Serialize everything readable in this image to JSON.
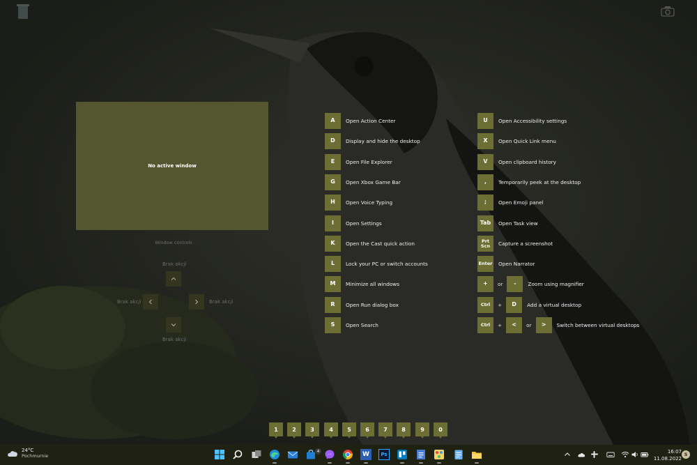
{
  "preview": {
    "message": "No active window",
    "controls_title": "Window controls",
    "direction_labels": {
      "up": "Brak akcji",
      "left": "Brak akcji",
      "right": "Brak akcji",
      "down": "Brak akcji"
    }
  },
  "shortcuts_left": [
    {
      "key": "A",
      "desc": "Open Action Center"
    },
    {
      "key": "D",
      "desc": "Display and hide the desktop"
    },
    {
      "key": "E",
      "desc": "Open File Explorer"
    },
    {
      "key": "G",
      "desc": "Open Xbox Game Bar"
    },
    {
      "key": "H",
      "desc": "Open Voice Typing"
    },
    {
      "key": "I",
      "desc": "Open Settings"
    },
    {
      "key": "K",
      "desc": "Open the Cast quick action"
    },
    {
      "key": "L",
      "desc": "Lock your PC or switch accounts"
    },
    {
      "key": "M",
      "desc": "Minimize all windows"
    },
    {
      "key": "R",
      "desc": "Open Run dialog box"
    },
    {
      "key": "S",
      "desc": "Open Search"
    }
  ],
  "shortcuts_right": [
    {
      "key": "U",
      "desc": "Open Accessibility settings"
    },
    {
      "key": "X",
      "desc": "Open Quick Link menu"
    },
    {
      "key": "V",
      "desc": "Open clipboard history"
    },
    {
      "key": ",",
      "desc": "Temporarily peek at the desktop"
    },
    {
      "key": ";",
      "desc": "Open Emoji panel"
    },
    {
      "key": "Tab",
      "desc": "Open Task view"
    },
    {
      "key": "Prt Scn",
      "desc": "Capture a screenshot"
    },
    {
      "key": "Enter",
      "desc": "Open Narrator"
    }
  ],
  "combo_shortcuts": {
    "magnifier": {
      "key1": "+",
      "sep": "or",
      "key2": "-",
      "desc": "Zoom using magnifier"
    },
    "add_desktop": {
      "key1": "Ctrl",
      "sep": "+",
      "key2": "D",
      "desc": "Add a virtual desktop"
    },
    "switch_desktop": {
      "key1": "Ctrl",
      "sep1": "+",
      "key2": "<",
      "sep2": "or",
      "key3": ">",
      "desc": "Switch between virtual desktops"
    }
  },
  "desktop_numbers": [
    "1",
    "2",
    "3",
    "4",
    "5",
    "6",
    "7",
    "8",
    "9",
    "0"
  ],
  "taskbar": {
    "weather": {
      "temp": "24°C",
      "condition": "Pochmurnie"
    },
    "mail_badge": "4",
    "apps": [
      {
        "name": "start-icon"
      },
      {
        "name": "search-icon"
      },
      {
        "name": "task-view-icon"
      },
      {
        "name": "edge-icon"
      },
      {
        "name": "mail-icon"
      },
      {
        "name": "store-icon"
      },
      {
        "name": "messenger-icon"
      },
      {
        "name": "chrome-icon"
      },
      {
        "name": "word-icon",
        "glyph": "W"
      },
      {
        "name": "photoshop-icon",
        "glyph": "Ps"
      },
      {
        "name": "trello-icon"
      },
      {
        "name": "gmail-docs-icon"
      },
      {
        "name": "paint-icon"
      },
      {
        "name": "notepad-icon"
      },
      {
        "name": "file-explorer-icon"
      }
    ],
    "clock": {
      "time": "16:07",
      "date": "11.08.2022"
    },
    "notification_count": "5"
  },
  "colors": {
    "accent": "#6d6e34",
    "preview_bg": "#545630",
    "taskbar_bg": "#1f2213"
  }
}
